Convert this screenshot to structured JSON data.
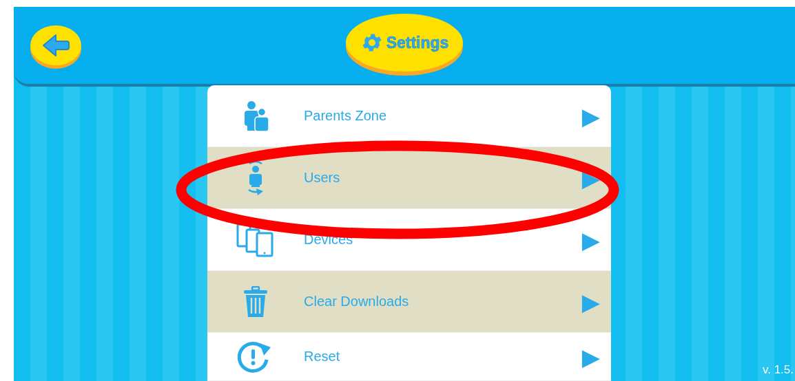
{
  "header": {
    "title": "Settings"
  },
  "menu": [
    {
      "kind": "parents",
      "label": "Parents Zone",
      "arrow": "▶"
    },
    {
      "kind": "users",
      "label": "Users",
      "arrow": "▶"
    },
    {
      "kind": "devices",
      "label": "Devices",
      "arrow": "▶"
    },
    {
      "kind": "trash",
      "label": "Clear Downloads",
      "arrow": "▶"
    },
    {
      "kind": "reset",
      "label": "Reset",
      "arrow": "▶"
    }
  ],
  "version": "v. 1.5."
}
